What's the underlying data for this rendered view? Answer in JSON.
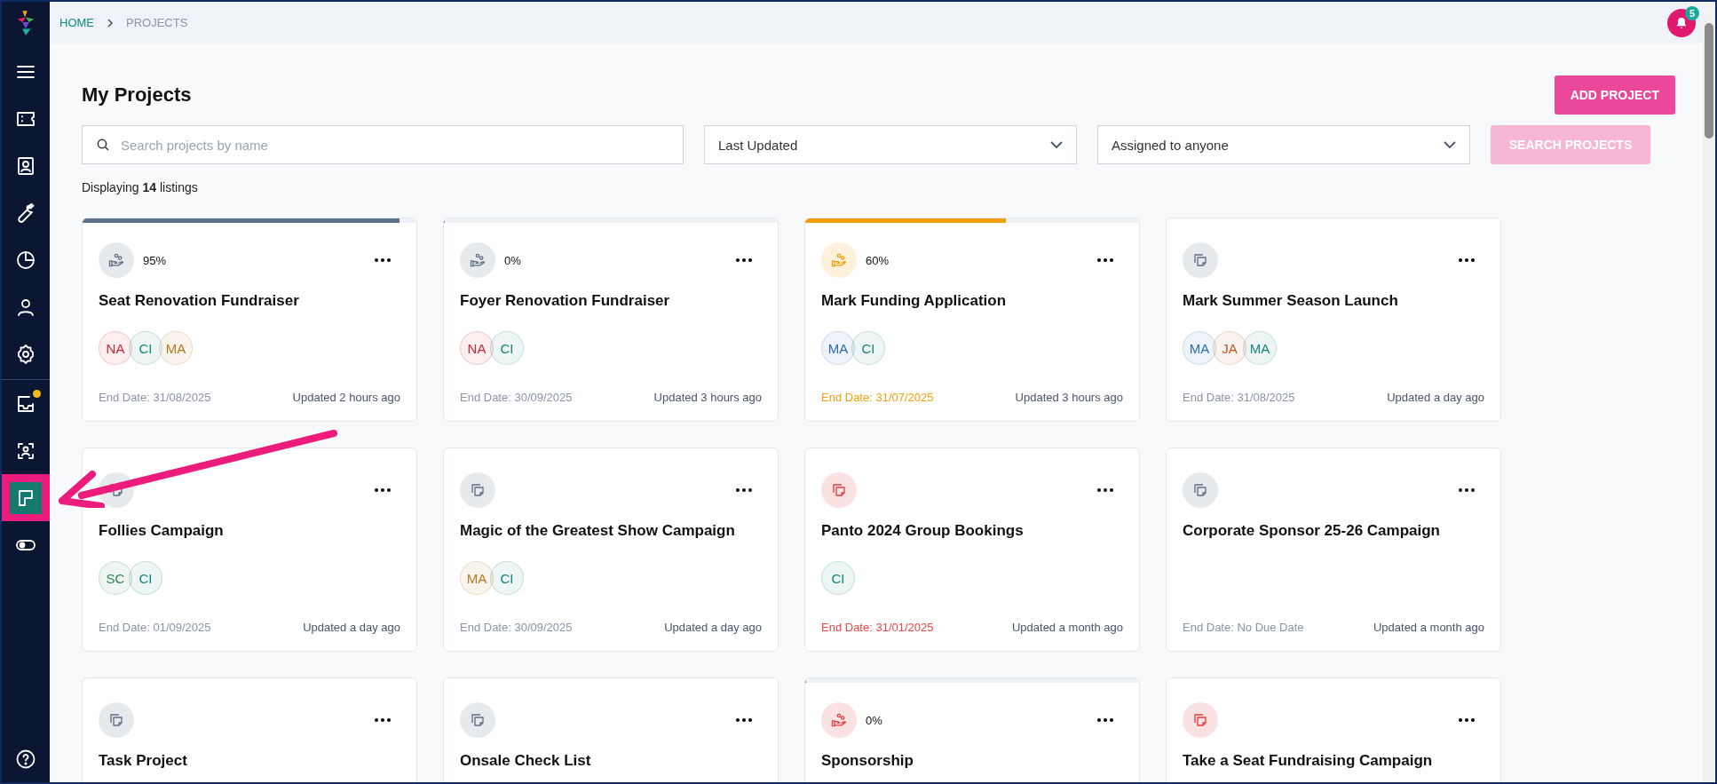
{
  "sidebar": {
    "primary_items": [
      {
        "kind": "menu",
        "selected": false,
        "notification": false,
        "highlighted": false
      },
      {
        "kind": "ticket",
        "selected": false,
        "notification": false,
        "highlighted": false
      },
      {
        "kind": "contact",
        "selected": false,
        "notification": false,
        "highlighted": false
      },
      {
        "kind": "wrench",
        "selected": false,
        "notification": false,
        "highlighted": false
      },
      {
        "kind": "chart",
        "selected": false,
        "notification": false,
        "highlighted": false
      },
      {
        "kind": "person",
        "selected": false,
        "notification": false,
        "highlighted": false
      },
      {
        "kind": "settings",
        "selected": false,
        "notification": false,
        "highlighted": false
      }
    ],
    "secondary_items": [
      {
        "kind": "inbox",
        "selected": false,
        "notification": true,
        "highlighted": false
      },
      {
        "kind": "scan",
        "selected": false,
        "notification": false,
        "highlighted": false
      },
      {
        "kind": "board",
        "selected": true,
        "notification": false,
        "highlighted": true
      },
      {
        "kind": "toggle",
        "selected": false,
        "notification": false,
        "highlighted": false
      }
    ],
    "footer_item": {
      "selected": false
    }
  },
  "breadcrumb": [
    {
      "label": "HOME",
      "selected": false
    },
    {
      "label": "PROJECTS",
      "selected": true
    }
  ],
  "notifications": {
    "count": "5"
  },
  "page_title": "My Projects",
  "add_button": "ADD PROJECT",
  "filters": {
    "search": {
      "placeholder": "Search projects by name"
    },
    "sort": {
      "value": "Last Updated"
    },
    "assignee": {
      "value": "Assigned to anyone"
    },
    "search_button": {
      "label": "SEARCH PROJECTS",
      "disabled": true
    }
  },
  "listing_summary": "Displaying **14** listings",
  "projects": [
    {
      "kind": "funding",
      "color": "#5f6f85",
      "percent": "95%",
      "level": 0.95,
      "title": "Seat Renovation Fundraiser",
      "assignees": [
        {
          "initials": "NA",
          "color": "#c62838"
        },
        {
          "initials": "CI",
          "color": "#14857a"
        },
        {
          "initials": "MA",
          "color": "#b7791f"
        }
      ],
      "end_date": "End Date: 31/08/2025",
      "due_soon": false,
      "overdue": false,
      "updated": "Updated 2 hours ago"
    },
    {
      "kind": "funding",
      "color": "#5f6f85",
      "percent": "0%",
      "level": 0,
      "title": "Foyer Renovation Fundraiser",
      "assignees": [
        {
          "initials": "NA",
          "color": "#c62838"
        },
        {
          "initials": "CI",
          "color": "#14857a"
        }
      ],
      "end_date": "End Date: 30/09/2025",
      "due_soon": false,
      "overdue": false,
      "updated": "Updated 3 hours ago"
    },
    {
      "kind": "funding",
      "color": "#f59e0b",
      "percent": "60%",
      "level": 0.6,
      "title": "Mark Funding Application",
      "assignees": [
        {
          "initials": "MA",
          "color": "#2b6cb0"
        },
        {
          "initials": "CI",
          "color": "#14857a"
        }
      ],
      "end_date": "End Date: 31/07/2025",
      "due_soon": true,
      "overdue": false,
      "updated": "Updated 3 hours ago"
    },
    {
      "kind": "task",
      "color": "#5f6f85",
      "title": "Mark Summer Season Launch",
      "assignees": [
        {
          "initials": "MA",
          "color": "#2b6cb0"
        },
        {
          "initials": "JA",
          "color": "#c05621"
        },
        {
          "initials": "MA",
          "color": "#14857a"
        }
      ],
      "end_date": "End Date: 31/08/2025",
      "due_soon": false,
      "overdue": false,
      "updated": "Updated a day ago"
    },
    {
      "kind": "task",
      "color": "#5f6f85",
      "title": "Follies Campaign",
      "assignees": [
        {
          "initials": "SC",
          "color": "#2f855a"
        },
        {
          "initials": "CI",
          "color": "#14857a"
        }
      ],
      "end_date": "End Date: 01/09/2025",
      "due_soon": false,
      "overdue": false,
      "updated": "Updated a day ago"
    },
    {
      "kind": "task",
      "color": "#5f6f85",
      "title": "Magic of the Greatest Show Campaign",
      "assignees": [
        {
          "initials": "MA",
          "color": "#b7791f"
        },
        {
          "initials": "CI",
          "color": "#14857a"
        }
      ],
      "end_date": "End Date: 30/09/2025",
      "due_soon": false,
      "overdue": false,
      "updated": "Updated a day ago"
    },
    {
      "kind": "task",
      "color": "#e53e3e",
      "title": "Panto 2024 Group Bookings",
      "assignees": [
        {
          "initials": "CI",
          "color": "#14857a"
        }
      ],
      "end_date": "End Date: 31/01/2025",
      "due_soon": false,
      "overdue": true,
      "updated": "Updated a month ago"
    },
    {
      "kind": "task",
      "color": "#5f6f85",
      "title": "Corporate Sponsor 25-26 Campaign",
      "end_date": "End Date: No Due Date",
      "due_soon": false,
      "overdue": false,
      "updated": "Updated a month ago"
    },
    {
      "kind": "task",
      "color": "#5f6f85",
      "title": "Task Project"
    },
    {
      "kind": "task",
      "color": "#5f6f85",
      "title": "Onsale Check List"
    },
    {
      "kind": "funding",
      "color": "#e53e3e",
      "percent": "0%",
      "level": 0,
      "title": "Sponsorship"
    },
    {
      "kind": "task",
      "color": "#e53e3e",
      "title": "Take a Seat Fundraising Campaign"
    }
  ]
}
